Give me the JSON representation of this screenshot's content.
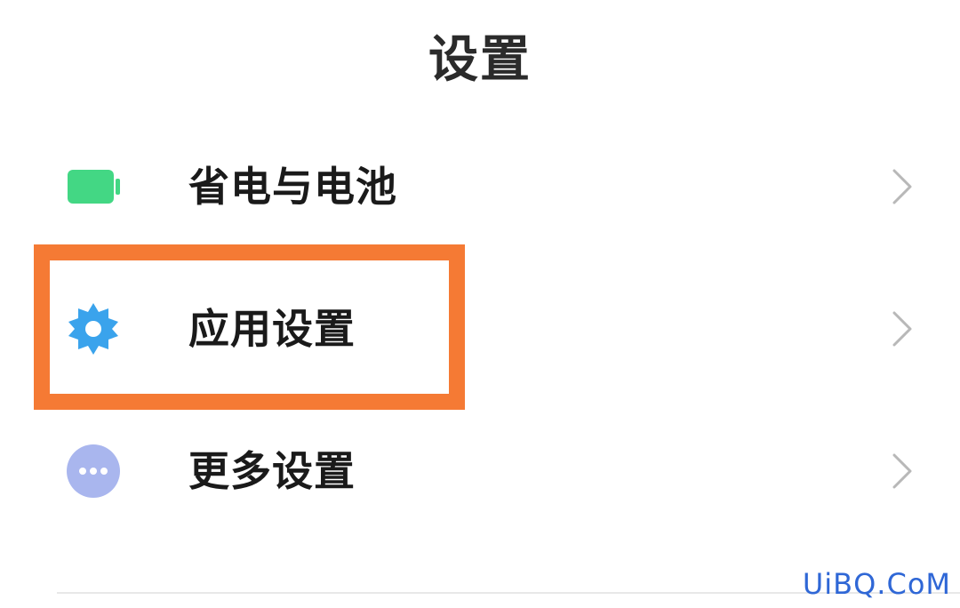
{
  "header": {
    "title": "设置"
  },
  "settings": {
    "items": [
      {
        "label": "省电与电池",
        "icon": "battery-icon",
        "icon_color": "#43d784"
      },
      {
        "label": "应用设置",
        "icon": "gear-icon",
        "icon_color": "#3aa3ec"
      },
      {
        "label": "更多设置",
        "icon": "more-dots-icon",
        "icon_color": "#a9b6ee"
      }
    ]
  },
  "highlight": {
    "color": "#f57a34"
  },
  "watermark": {
    "text": "UiBQ.CoM",
    "color": "#2f67d6"
  }
}
